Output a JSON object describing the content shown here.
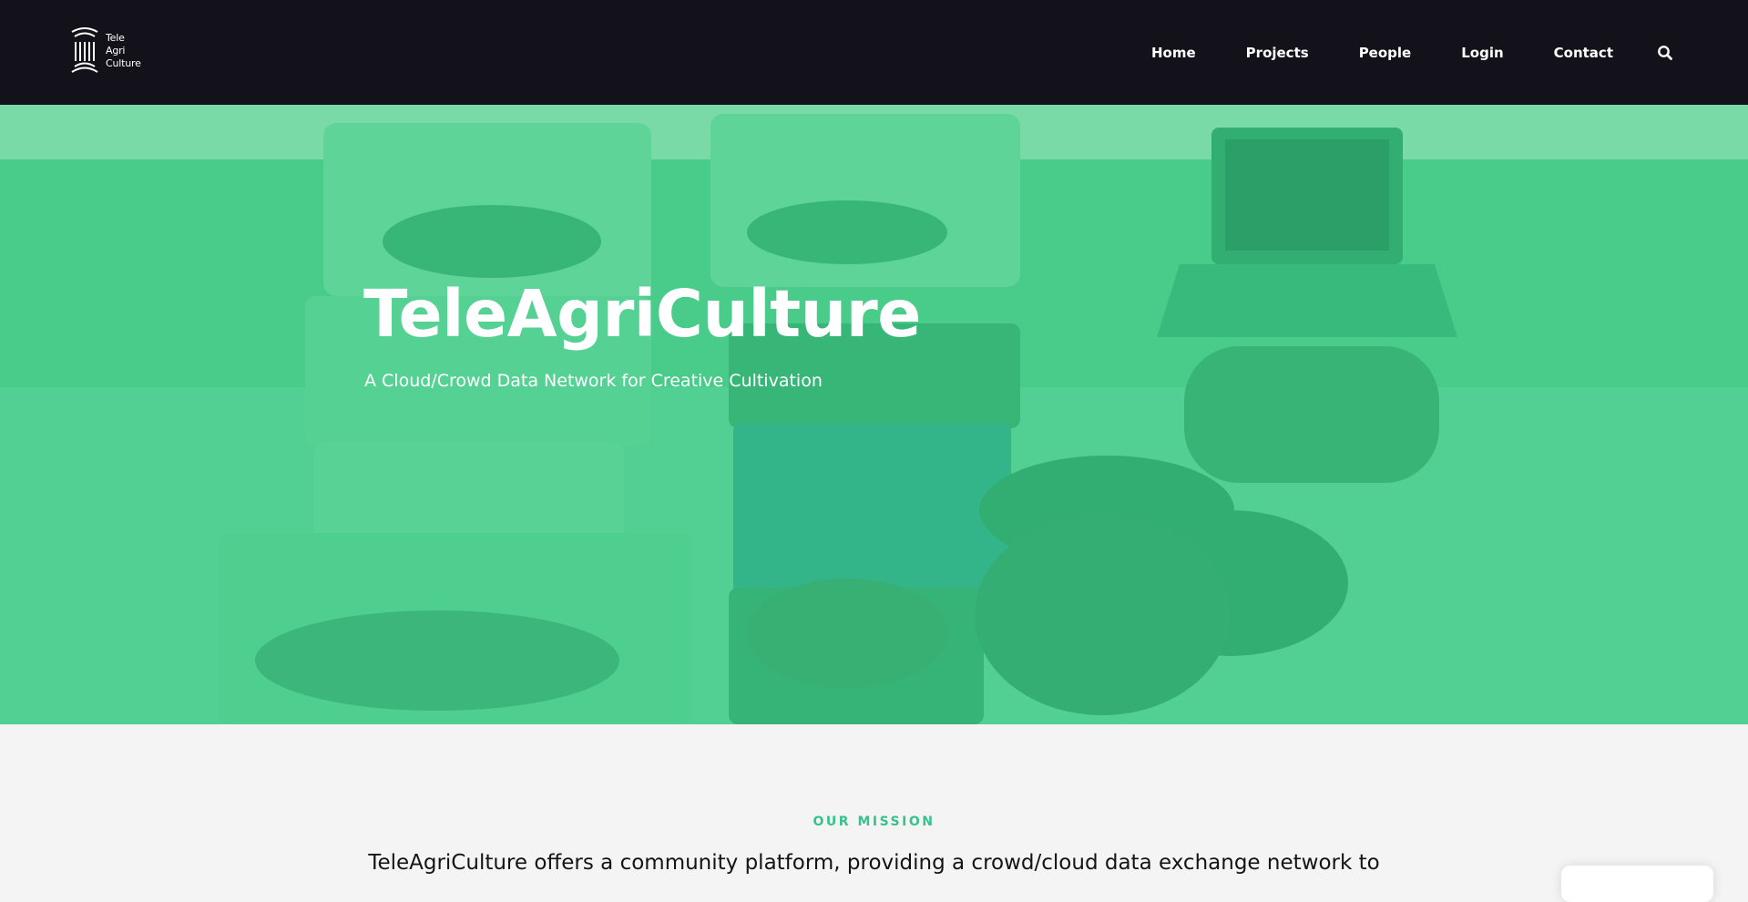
{
  "header": {
    "logo_lines": [
      "Tele",
      "Agri",
      "Culture"
    ],
    "nav": [
      {
        "label": "Home"
      },
      {
        "label": "Projects"
      },
      {
        "label": "People"
      },
      {
        "label": "Login"
      },
      {
        "label": "Contact"
      }
    ],
    "search_icon": "search-icon"
  },
  "hero": {
    "title": "TeleAgriCulture",
    "subtitle": "A Cloud/Crowd Data Network for Creative Cultivation"
  },
  "mission": {
    "label": "OUR MISSION",
    "text": "TeleAgriCulture offers a community platform, providing a crowd/cloud data exchange network to"
  },
  "colors": {
    "header_bg": "#13121a",
    "hero_overlay": "#37c882",
    "accent": "#35c38b",
    "page_bg": "#f4f4f4"
  }
}
